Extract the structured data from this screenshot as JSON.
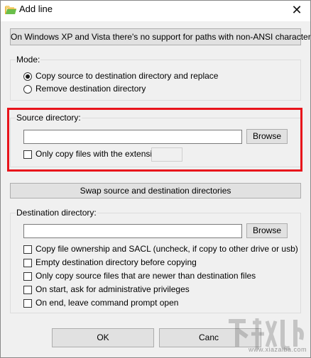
{
  "window": {
    "title": "Add line",
    "close_glyph": "✕"
  },
  "notice_button": "On Windows XP and Vista there's no support for paths with non-ANSI characters!",
  "mode": {
    "label": "Mode:",
    "options": [
      {
        "label": "Copy source to destination directory and replace",
        "checked": true
      },
      {
        "label": "Remove destination directory",
        "checked": false
      }
    ]
  },
  "source": {
    "label": "Source directory:",
    "path_value": "",
    "browse_label": "Browse",
    "ext_checkbox_label": "Only copy files with the extension:",
    "ext_value": ""
  },
  "swap_button": "Swap source and destination directories",
  "destination": {
    "label": "Destination directory:",
    "path_value": "",
    "browse_label": "Browse",
    "options": [
      "Copy file ownership and SACL (uncheck, if copy to other drive or usb)",
      "Empty destination directory before copying",
      "Only copy source files that are newer than destination files",
      "On start, ask for administrative privileges",
      "On end, leave command prompt open"
    ]
  },
  "footer": {
    "ok_label": "OK",
    "cancel_label": "Canc"
  },
  "watermark": {
    "url": "www.xiazaiba.com"
  },
  "colors": {
    "highlight": "#e8141b",
    "dialog_bg": "#f0f0f0",
    "button_bg": "#e1e1e1"
  }
}
